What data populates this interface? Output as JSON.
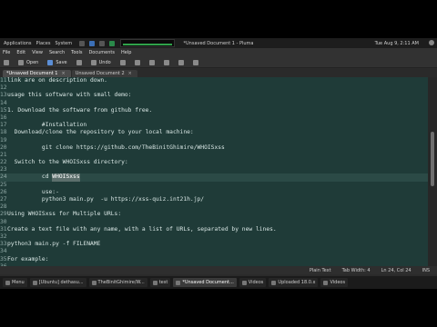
{
  "topbar": {
    "menus": [
      "Applications",
      "Places",
      "System"
    ],
    "window_title": "*Unsaved Document 1 - Pluma",
    "clock": "Tue Aug 9, 2:11 AM"
  },
  "menubar": [
    "File",
    "Edit",
    "View",
    "Search",
    "Tools",
    "Documents",
    "Help"
  ],
  "toolbar": {
    "open": "Open",
    "save": "Save",
    "undo": "Undo"
  },
  "tabs": [
    {
      "label": "*Unsaved Document 1",
      "active": true
    },
    {
      "label": "Unsaved Document 2",
      "active": false
    }
  ],
  "editor": {
    "lines": [
      {
        "n": "11",
        "text": "link are on description down."
      },
      {
        "n": "12",
        "text": ""
      },
      {
        "n": "13",
        "text": "usage this software with small demo:"
      },
      {
        "n": "14",
        "text": ""
      },
      {
        "n": "15",
        "text": "1. Download the software from github free."
      },
      {
        "n": "16",
        "text": ""
      },
      {
        "n": "17",
        "text": "          #Installation"
      },
      {
        "n": "18",
        "text": "  Download/clone the repository to your local machine:"
      },
      {
        "n": "19",
        "text": ""
      },
      {
        "n": "20",
        "text": "          git clone https://github.com/TheBinitGhimire/WHOISxss"
      },
      {
        "n": "21",
        "text": ""
      },
      {
        "n": "22",
        "text": "  Switch to the WHOISxss directory:"
      },
      {
        "n": "23",
        "text": ""
      },
      {
        "n": "24",
        "text": "          cd ",
        "sel": "WHOISxss",
        "cursor": true
      },
      {
        "n": "25",
        "text": ""
      },
      {
        "n": "26",
        "text": "          use:-"
      },
      {
        "n": "27",
        "text": "          python3 main.py  -u https://xss-quiz.int21h.jp/"
      },
      {
        "n": "28",
        "text": ""
      },
      {
        "n": "29",
        "text": "Using WHOISxss for Multiple URLs:"
      },
      {
        "n": "30",
        "text": ""
      },
      {
        "n": "31",
        "text": "Create a text file with any name, with a list of URLs, separated by new lines."
      },
      {
        "n": "32",
        "text": ""
      },
      {
        "n": "33",
        "text": "python3 main.py -f FILENAME"
      },
      {
        "n": "34",
        "text": ""
      },
      {
        "n": "35",
        "text": "For example:"
      },
      {
        "n": "36",
        "text": ""
      }
    ]
  },
  "statusbar": {
    "syntax": "Plain Text",
    "tab_width": "Tab Width: 4",
    "position": "Ln 24, Col 24",
    "mode": "INS"
  },
  "taskbar": {
    "items": [
      {
        "label": "Menu",
        "active": false
      },
      {
        "label": "[Ubuntu] dethasu...",
        "active": false
      },
      {
        "label": "TheBinitGhimire/W...",
        "active": false
      },
      {
        "label": "test",
        "active": false
      },
      {
        "label": "*Unsaved Document...",
        "active": true
      },
      {
        "label": "Videos",
        "active": false
      },
      {
        "label": "Uploaded 18.0.x",
        "active": false
      },
      {
        "label": "Videos",
        "active": false
      }
    ]
  }
}
